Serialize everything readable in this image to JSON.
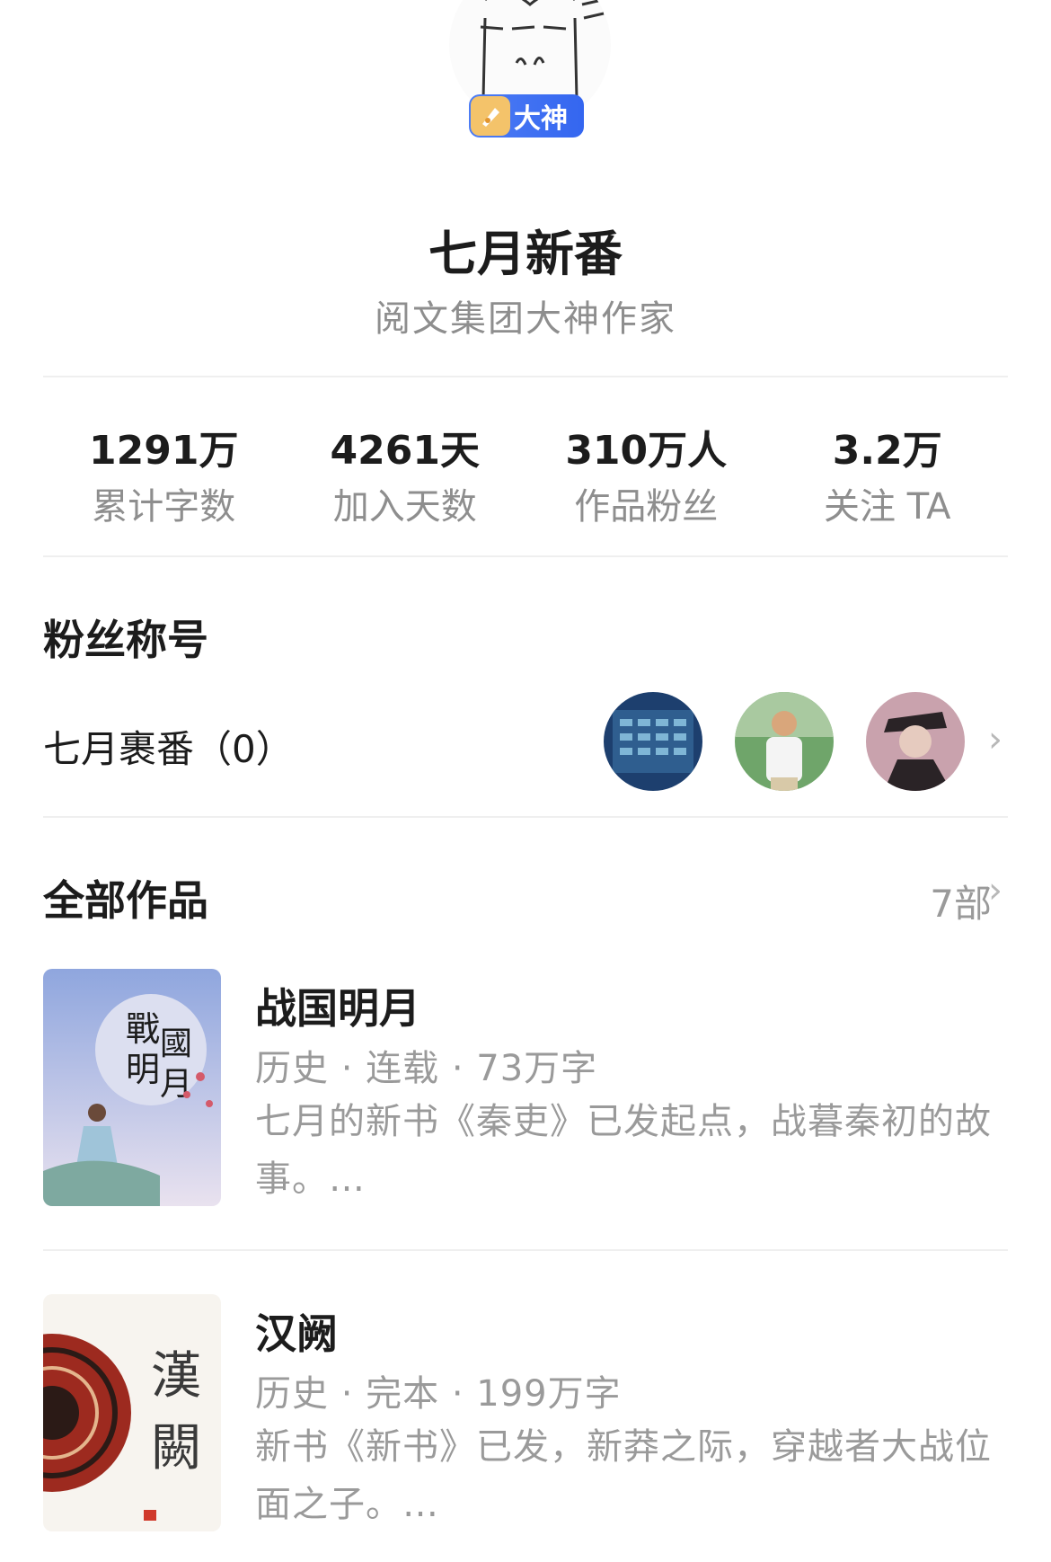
{
  "profile": {
    "badge_label": "大神",
    "name": "七月新番",
    "title": "阅文集团大神作家"
  },
  "stats": [
    {
      "value": "1291万",
      "label": "累计字数"
    },
    {
      "value": "4261天",
      "label": "加入天数"
    },
    {
      "value": "310万人",
      "label": "作品粉丝"
    },
    {
      "value": "3.2万",
      "label": "关注 TA"
    }
  ],
  "fans": {
    "section_title": "粉丝称号",
    "fan_title": "七月裹番（0）"
  },
  "works": {
    "section_title": "全部作品",
    "count": "7部",
    "books": [
      {
        "name": "战国明月",
        "meta": "历史 · 连载 · 73万字",
        "desc": "七月的新书《秦吏》已发起点，战暮秦初的故事。…"
      },
      {
        "name": "汉阙",
        "meta": "历史 · 完本 · 199万字",
        "desc": "新书《新书》已发，新莽之际，穿越者大战位面之子。…"
      }
    ]
  },
  "colors": {
    "badge": "#3466f0",
    "text_primary": "#1c1c1c",
    "text_secondary": "#8e8e8e"
  }
}
